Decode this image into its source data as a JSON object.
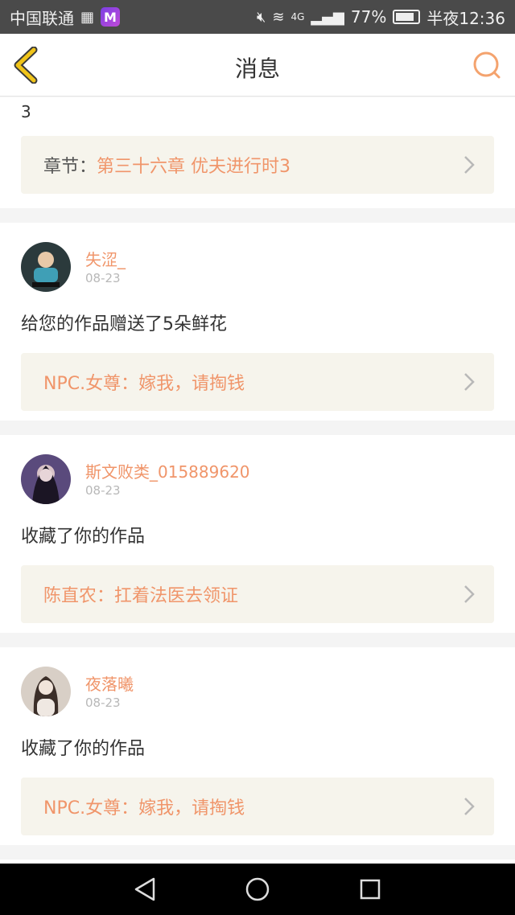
{
  "status_bar": {
    "carrier": "中国联通",
    "app_letter": "M",
    "network": "4G",
    "battery": "77%",
    "time": "半夜12:36"
  },
  "header": {
    "title": "消息"
  },
  "first_card": {
    "stray_text": "3",
    "work_prefix": "章节：",
    "work_title": "第三十六章 优夫进行时3"
  },
  "messages": [
    {
      "username": "失涩_",
      "date": "08-23",
      "text": "给您的作品赠送了5朵鲜花",
      "work_title": "NPC.女尊：嫁我，请掏钱"
    },
    {
      "username": "斯文败类_015889620",
      "date": "08-23",
      "text": "收藏了你的作品",
      "work_title": "陈直农：扛着法医去领证"
    },
    {
      "username": "夜落曦",
      "date": "08-23",
      "text": "收藏了你的作品",
      "work_title": "NPC.女尊：嫁我，请掏钱"
    }
  ],
  "colors": {
    "accent": "#f0956a",
    "link_bg": "#f6f4ec",
    "back_icon": "#f0c419",
    "search_icon": "#f4a36e"
  }
}
